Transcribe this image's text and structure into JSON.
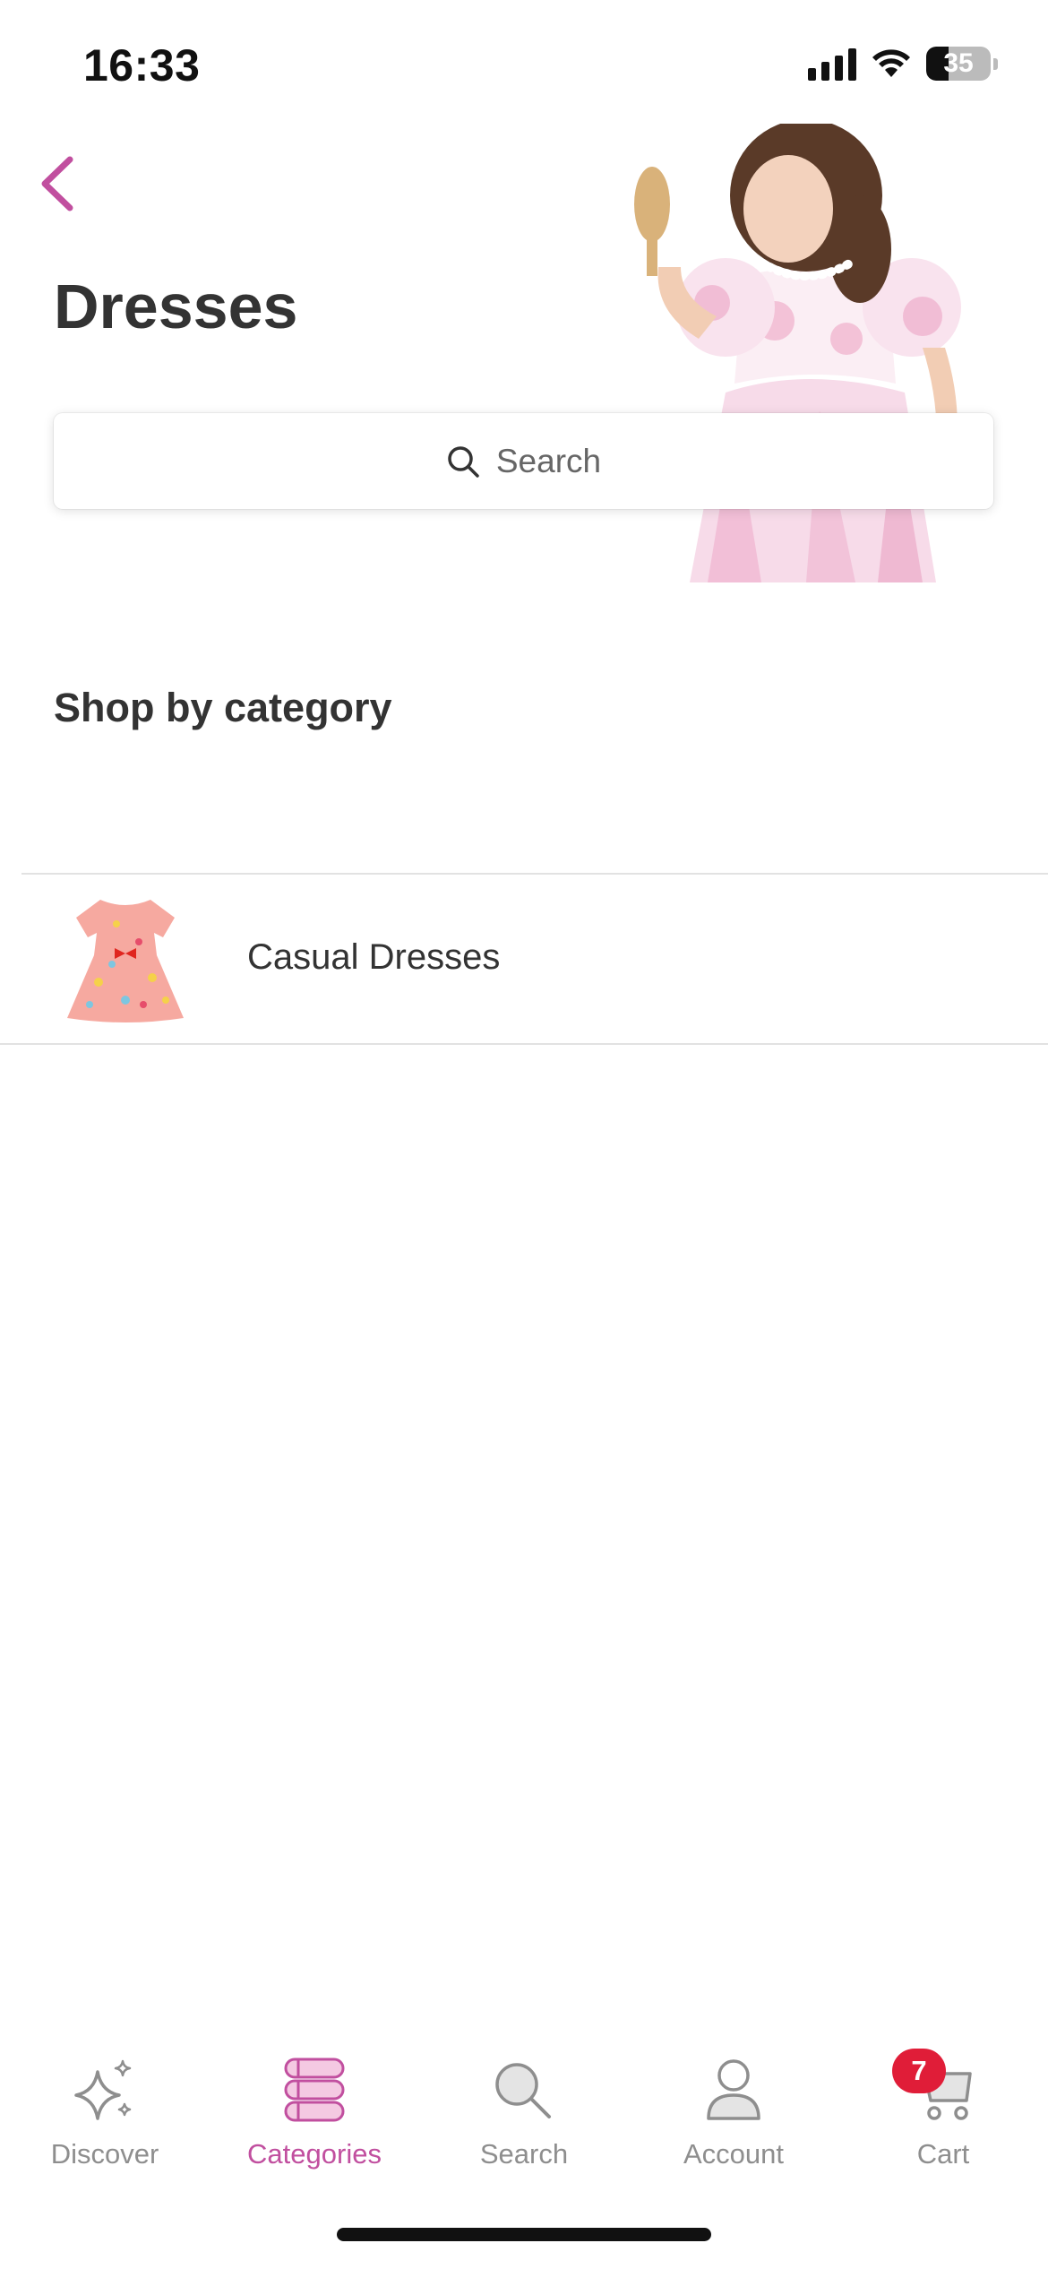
{
  "status_bar": {
    "time": "16:33",
    "battery": "35",
    "battery_level": 0.35
  },
  "header": {
    "title": "Dresses"
  },
  "search": {
    "placeholder": "Search"
  },
  "section": {
    "title": "Shop by category"
  },
  "categories": [
    {
      "label": "Casual Dresses"
    }
  ],
  "tab_bar": {
    "items": [
      {
        "label": "Discover",
        "icon": "sparkle-icon",
        "active": false
      },
      {
        "label": "Categories",
        "icon": "categories-icon",
        "active": true
      },
      {
        "label": "Search",
        "icon": "search-icon",
        "active": false
      },
      {
        "label": "Account",
        "icon": "account-icon",
        "active": false
      },
      {
        "label": "Cart",
        "icon": "cart-icon",
        "active": false
      }
    ],
    "cart_badge": "7"
  },
  "colors": {
    "accent": "#c14f9f",
    "badge": "#e01d38",
    "inactive": "#8e8e8e"
  }
}
